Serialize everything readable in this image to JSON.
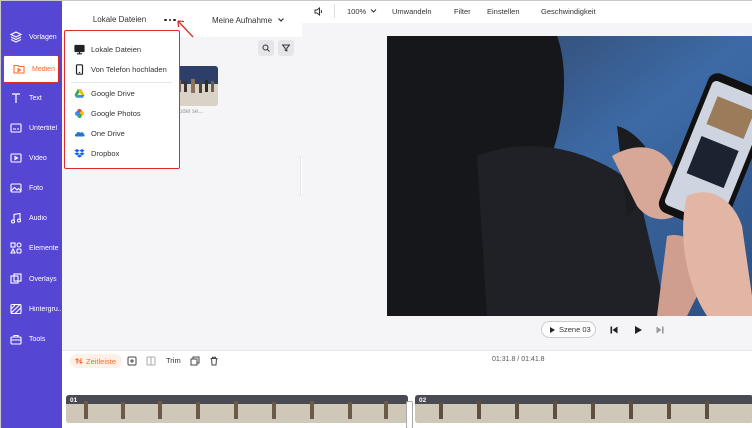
{
  "sidebar": {
    "items": [
      {
        "label": "Vorlagen",
        "icon": "templates-icon"
      },
      {
        "label": "Medien",
        "icon": "media-icon",
        "active": true
      },
      {
        "label": "Text",
        "icon": "text-icon"
      },
      {
        "label": "Untertitel",
        "icon": "subtitle-icon"
      },
      {
        "label": "Video",
        "icon": "video-icon"
      },
      {
        "label": "Foto",
        "icon": "photo-icon"
      },
      {
        "label": "Audio",
        "icon": "audio-icon"
      },
      {
        "label": "Elemente",
        "icon": "elements-icon"
      },
      {
        "label": "Overlays",
        "icon": "overlays-icon"
      },
      {
        "label": "Hintergru...",
        "icon": "background-icon"
      },
      {
        "label": "Tools",
        "icon": "tools-icon"
      }
    ]
  },
  "panel": {
    "tab_local": "Lokale Dateien",
    "tab_recordings": "Meine Aufnahme",
    "thumb_caption": "model se..."
  },
  "dropdown": {
    "items": [
      {
        "label": "Lokale Dateien",
        "icon": "monitor-icon"
      },
      {
        "label": "Von Telefon hochladen",
        "icon": "phone-icon"
      },
      {
        "label": "Google Drive",
        "icon": "google-drive-icon"
      },
      {
        "label": "Google Photos",
        "icon": "google-photos-icon"
      },
      {
        "label": "One Drive",
        "icon": "onedrive-icon"
      },
      {
        "label": "Dropbox",
        "icon": "dropbox-icon"
      }
    ]
  },
  "toolbar": {
    "zoom": "100%",
    "convert": "Umwandeln",
    "filter": "Filter",
    "settings": "Einstellen",
    "speed": "Geschwindigkeit"
  },
  "preview": {
    "scene_label": "Szene 03"
  },
  "timeline": {
    "timeline_label": "Zeitleiste",
    "trim_label": "Trim",
    "current_time": "01:31.8",
    "total_time": "01:41.8",
    "time_separator": " / ",
    "clips": [
      {
        "number": "01"
      },
      {
        "number": "02"
      }
    ]
  },
  "colors": {
    "sidebar": "#5646d4",
    "accent": "#ff6a2a",
    "highlight": "#e02a2a"
  }
}
